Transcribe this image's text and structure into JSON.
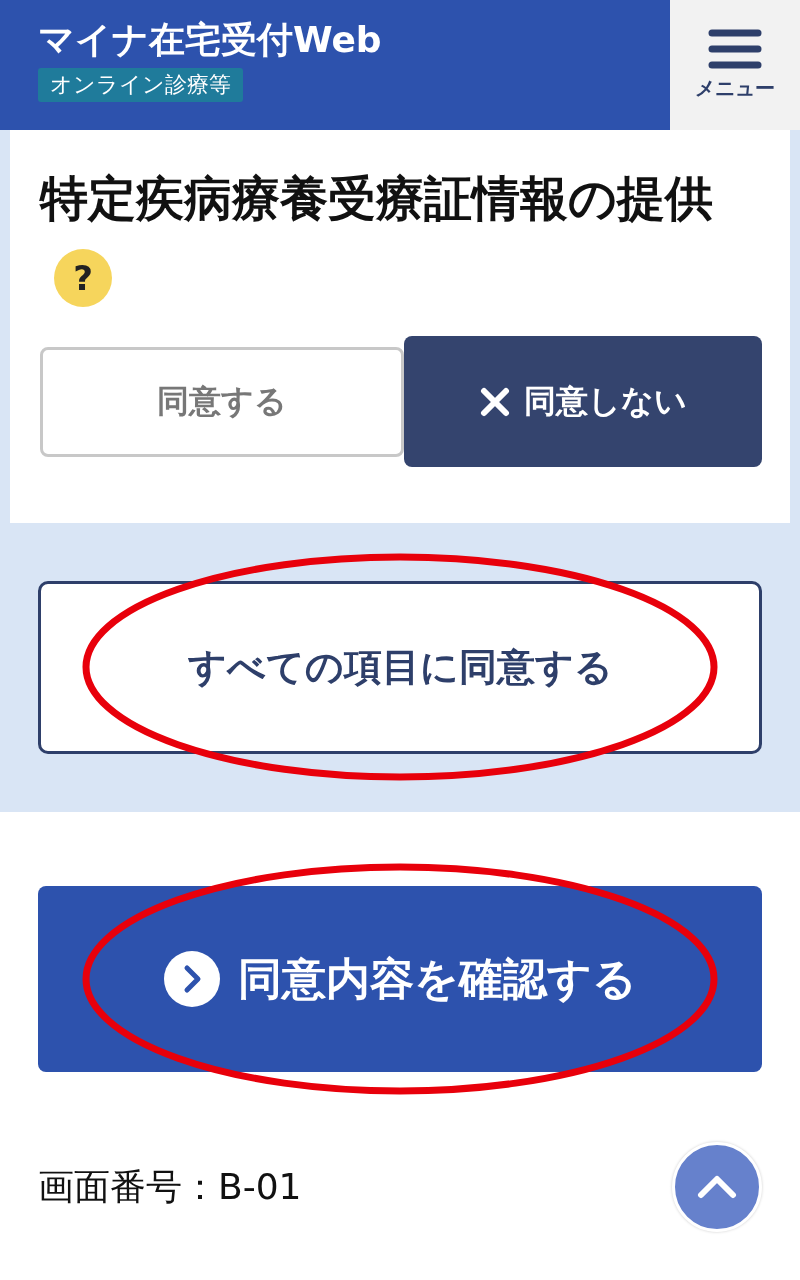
{
  "header": {
    "title": "マイナ在宅受付Web",
    "badge": "オンライン診療等",
    "menu_label": "メニュー"
  },
  "section": {
    "title": "特定疾病療養受療証情報の提供",
    "help": "?"
  },
  "options": [
    {
      "label": "同意する",
      "selected": false
    },
    {
      "label": "同意しない",
      "selected": true
    }
  ],
  "agree_all_button": "すべての項目に同意する",
  "confirm_button": "同意内容を確認する",
  "screen_id": "画面番号：B-01"
}
